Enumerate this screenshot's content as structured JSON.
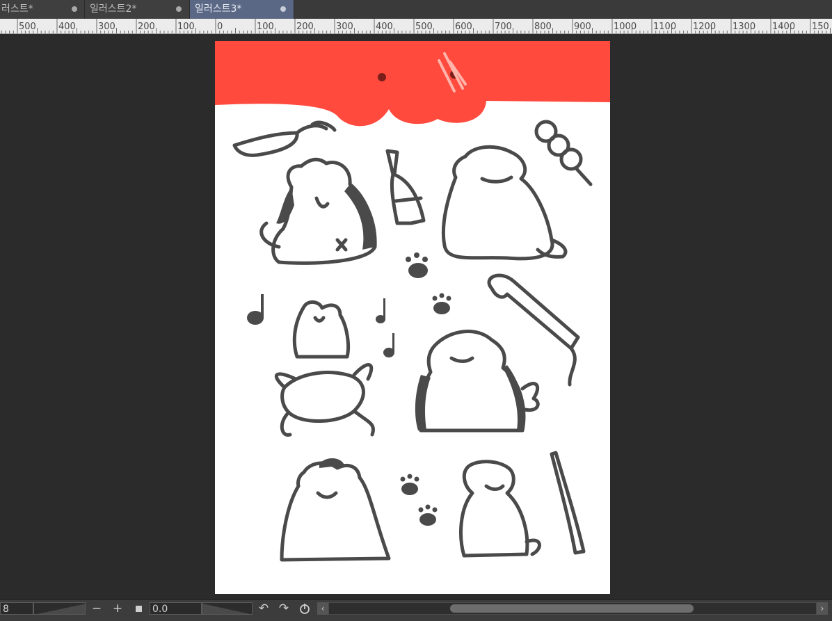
{
  "tabs": [
    {
      "label": "러스트*",
      "active": false
    },
    {
      "label": "일러스트2*",
      "active": false
    },
    {
      "label": "일러스트3*",
      "active": true
    }
  ],
  "ruler": {
    "labels": [
      "500",
      "400",
      "300",
      "200",
      "100",
      "0",
      "100",
      "200",
      "300",
      "400",
      "500",
      "600",
      "700",
      "800",
      "900",
      "1000",
      "1100",
      "1200",
      "1300",
      "1400",
      "150"
    ]
  },
  "colors": {
    "banner": "#ff4a3d",
    "ink": "#4a4a4a",
    "workspace": "#2b2b2b",
    "active_tab": "#5a6785"
  },
  "bottom": {
    "zoom_value": "8",
    "rotation_value": "0.0",
    "zoom_out_icon": "minus-icon",
    "zoom_in_icon": "plus-icon",
    "fit_icon": "square-icon",
    "rotate_left_icon": "rotate-left-icon",
    "rotate_right_icon": "rotate-right-icon",
    "reset_icon": "reset-rotation-icon"
  }
}
